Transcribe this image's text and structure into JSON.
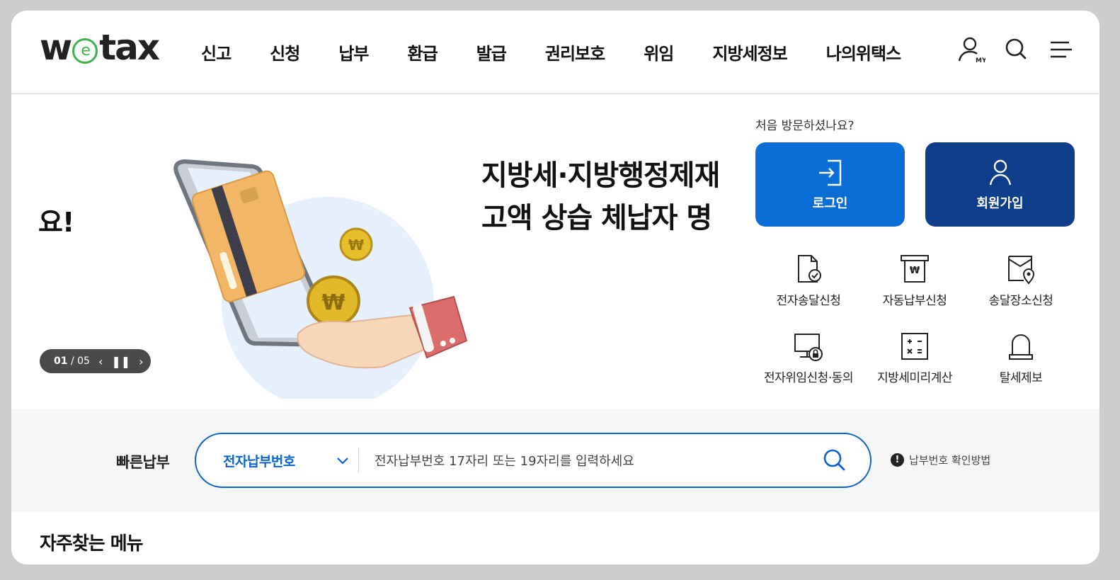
{
  "header": {
    "logo": {
      "w": "w",
      "e": "e",
      "tax": "tax"
    },
    "nav": [
      "신고",
      "신청",
      "납부",
      "환급",
      "발급",
      "권리보호",
      "위임",
      "지방세정보",
      "나의위택스"
    ],
    "icons": {
      "my": "user-my-icon",
      "my_badge": "MY",
      "search": "search-icon",
      "menu": "hamburger-menu-icon"
    }
  },
  "hero": {
    "prev_slide_text": "요!",
    "title_line1": "지방세·지방행정제재",
    "title_line2": "고액 상습 체납자 명",
    "illustration": "phone-card-coin-hand-illustration",
    "slider": {
      "current": "01",
      "separator": "/",
      "total": "05"
    }
  },
  "right_panel": {
    "visit_text": "처음 방문하셨나요?",
    "login_label": "로그인",
    "signup_label": "회원가입",
    "colors": {
      "login": "#0a6ed6",
      "signup": "#0f3d8a"
    },
    "quick_menu": [
      {
        "label": "전자송달신청",
        "icon": "document-check-icon"
      },
      {
        "label": "자동납부신청",
        "icon": "won-receipt-icon"
      },
      {
        "label": "송달장소신청",
        "icon": "envelope-location-icon"
      },
      {
        "label": "전자위임신청·동의",
        "icon": "monitor-lock-icon"
      },
      {
        "label": "지방세미리계산",
        "icon": "calculator-icon"
      },
      {
        "label": "탈세제보",
        "icon": "alarm-bell-icon"
      }
    ]
  },
  "quick_pay": {
    "label": "빠른납부",
    "select_value": "전자납부번호",
    "placeholder": "전자납부번호 17자리 또는 19자리를 입력하세요",
    "help": "납부번호 확인방법",
    "help_icon": "!"
  },
  "section": {
    "title": "자주찾는 메뉴"
  }
}
